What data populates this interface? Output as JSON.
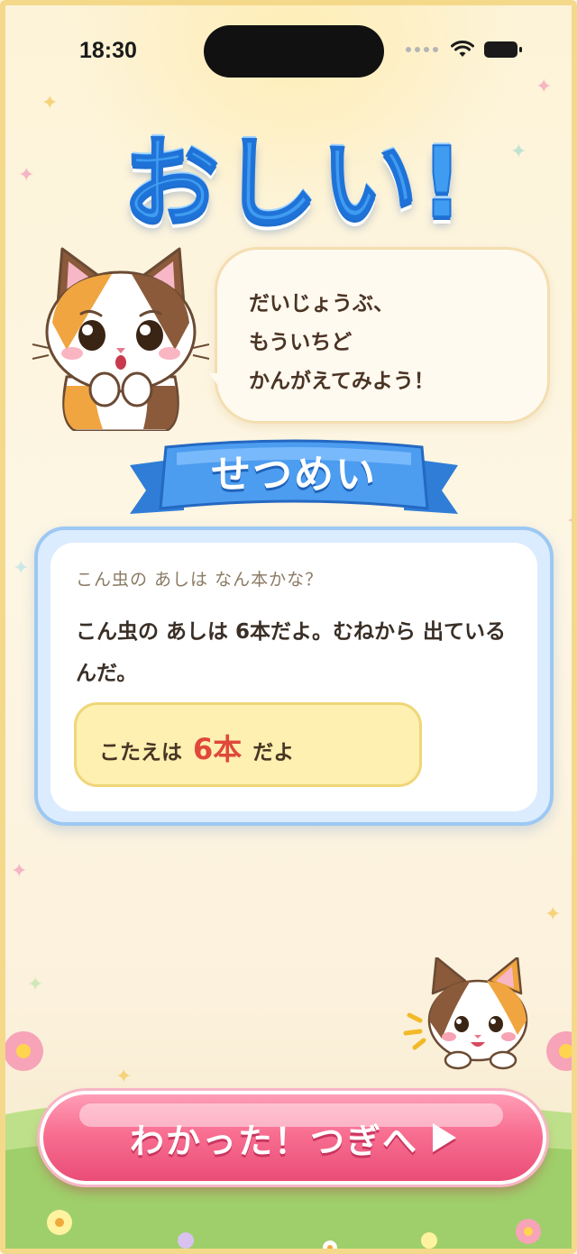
{
  "status_bar": {
    "time": "18:30",
    "icons": [
      "signal-dots-icon",
      "wifi-icon",
      "battery-icon"
    ]
  },
  "result": {
    "title": "おしい!",
    "message_lines": [
      "だいじょうぶ、",
      "もういちど",
      "かんがえてみよう！"
    ]
  },
  "explanation": {
    "heading": "せつめい",
    "question": "こん虫の あしは なん本かな？",
    "body": "こん虫の あしは 6本だよ。むねから 出ているんだ。",
    "answer_prefix": "こたえは",
    "answer_value": "6本",
    "answer_suffix": "だよ"
  },
  "next_button": {
    "label": "わかった！つぎへ",
    "icon": "play-arrow-icon"
  },
  "colors": {
    "title_blue": "#3f9cf0",
    "ribbon_blue": "#3d8fe6",
    "button_pink": "#f86e91",
    "answer_red": "#e0483a",
    "answer_bg": "#fdf0b0",
    "card_border": "#9cc8f3"
  }
}
